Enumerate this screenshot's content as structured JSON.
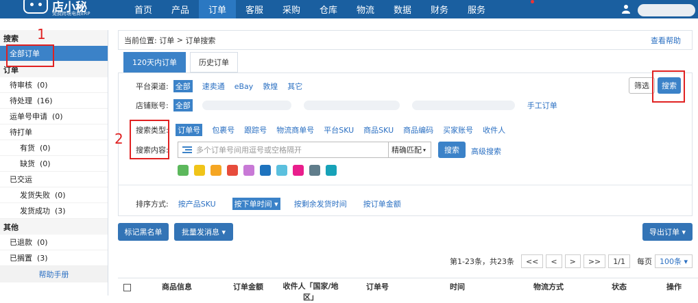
{
  "topbar": {
    "brand": "店小秘",
    "brand_sub": "免费跨境电商ERP",
    "nav": [
      "首页",
      "产品",
      "订单",
      "客服",
      "采购",
      "仓库",
      "物流",
      "数据",
      "财务",
      "服务"
    ],
    "active_nav": "订单"
  },
  "sidebar": {
    "search_head": "搜索",
    "all_orders": "全部订单",
    "order_head": "订单",
    "items": [
      {
        "label": "待审核",
        "count": "(0)"
      },
      {
        "label": "待处理",
        "count": "(16)"
      },
      {
        "label": "运单号申请",
        "count": "(0)"
      }
    ],
    "to_print": "待打单",
    "to_print_sub": [
      {
        "label": "有货",
        "count": "(0)"
      },
      {
        "label": "缺货",
        "count": "(0)"
      }
    ],
    "shipped": "已交运",
    "shipped_sub": [
      {
        "label": "发货失败",
        "count": "(0)"
      },
      {
        "label": "发货成功",
        "count": "(3)"
      }
    ],
    "other_head": "其他",
    "other_items": [
      {
        "label": "已退款",
        "count": "(0)"
      },
      {
        "label": "已搁置",
        "count": "(3)"
      }
    ],
    "help": "帮助手册"
  },
  "breadcrumb": {
    "prefix": "当前位置:",
    "path1": "订单",
    "sep": ">",
    "path2": "订单搜索",
    "help": "查看帮助"
  },
  "tabs": [
    "120天内订单",
    "历史订单"
  ],
  "filters": {
    "platform_label": "平台渠道:",
    "platforms": [
      "全部",
      "速卖通",
      "eBay",
      "敦煌",
      "其它"
    ],
    "store_label": "店铺账号:",
    "store_all": "全部",
    "manual": "手工订单",
    "filter_btn": "筛选",
    "search_btn": "搜索",
    "search_type_label": "搜索类型:",
    "search_types": [
      "订单号",
      "包裹号",
      "跟踪号",
      "物流商单号",
      "平台SKU",
      "商品SKU",
      "商品编码",
      "买家账号",
      "收件人"
    ],
    "search_content_label": "搜索内容:",
    "search_placeholder": "多个订单号间用逗号或空格隔开",
    "match_mode": "精确匹配",
    "search_btn2": "搜索",
    "advanced": "高级搜索",
    "colors": [
      "#5cb85c",
      "#f0c419",
      "#f5a623",
      "#e74c3c",
      "#c879d6",
      "#1e73be",
      "#5bc0de",
      "#e91e8c",
      "#607d8b",
      "#17a2b8"
    ],
    "sort_label": "排序方式:",
    "sort_options": [
      "按产品SKU",
      "按下单时间",
      "按剩余发货时间",
      "按订单金额"
    ],
    "sort_active": "按下单时间"
  },
  "toolbar": {
    "blacklist": "标记黑名单",
    "batch_msg": "批量发消息",
    "export": "导出订单"
  },
  "pager": {
    "summary": "第1-23条，共23条",
    "first": "<<",
    "prev": "<",
    "next": ">",
    "last": ">>",
    "page": "1/1",
    "per_page_label": "每页",
    "per_page": "100条"
  },
  "table": {
    "headers": [
      "商品信息",
      "订单金额",
      "收件人「国家/地区」",
      "订单号",
      "时间",
      "物流方式",
      "状态",
      "操作"
    ]
  },
  "annotations": {
    "one": "1",
    "two": "2"
  }
}
